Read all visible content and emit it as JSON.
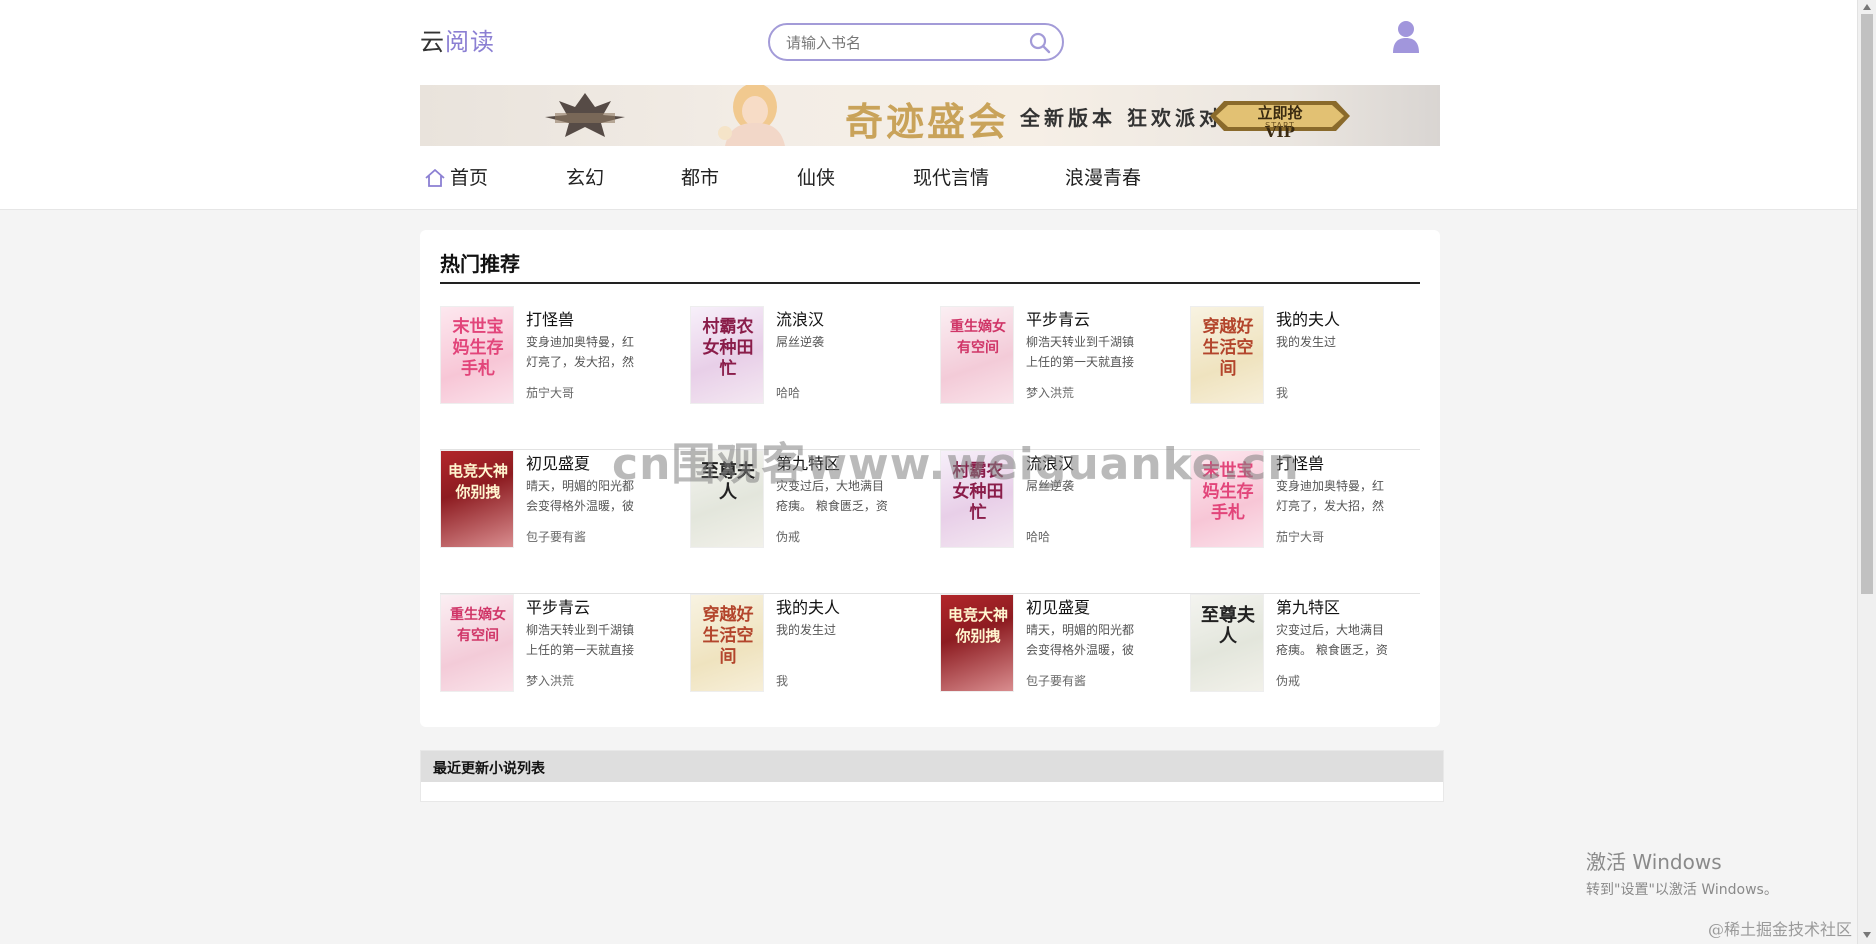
{
  "header": {
    "logo_part1": "云",
    "logo_part2": "阅读",
    "search_placeholder": "请输入书名"
  },
  "banner": {
    "title": "奇迹盛会",
    "slogan": "全新版本 狂欢派对",
    "vip_label": "立即抢VIP",
    "vip_sub": "START"
  },
  "nav": {
    "items": [
      {
        "label": "首页",
        "icon": "home-icon"
      },
      {
        "label": "玄幻"
      },
      {
        "label": "都市"
      },
      {
        "label": "仙侠"
      },
      {
        "label": "现代言情"
      },
      {
        "label": "浪漫青春"
      }
    ]
  },
  "hot": {
    "title": "热门推荐",
    "rows": [
      [
        {
          "title": "打怪兽",
          "desc": "变身迪加奥特曼，红灯亮了，发大招，然",
          "author": "茄宁大哥",
          "cover_text": "末世宝妈生存手札"
        },
        {
          "title": "流浪汉",
          "desc": "屌丝逆袭",
          "author": "哈哈",
          "cover_text": "村霸农女种田忙"
        },
        {
          "title": "平步青云",
          "desc": "柳浩天转业到千湖镇上任的第一天就直接",
          "author": "梦入洪荒",
          "cover_text": "重生嫡女有空间"
        },
        {
          "title": "我的夫人",
          "desc": "我的发生过",
          "author": "我",
          "cover_text": "穿越好生活空间"
        }
      ],
      [
        {
          "title": "初见盛夏",
          "desc": "晴天，明媚的阳光都会变得格外温暖，彼",
          "author": "包子要有酱",
          "cover_text": "电竞大神你别拽"
        },
        {
          "title": "第九特区",
          "desc": "灾变过后，大地满目疮痍。 粮食匮乏，资",
          "author": "伪戒",
          "cover_text": "至尊夫人"
        },
        {
          "title": "流浪汉",
          "desc": "屌丝逆袭",
          "author": "哈哈",
          "cover_text": "村霸农女种田忙"
        },
        {
          "title": "打怪兽",
          "desc": "变身迪加奥特曼，红灯亮了，发大招，然",
          "author": "茄宁大哥",
          "cover_text": "末世宝妈生存手札"
        }
      ],
      [
        {
          "title": "平步青云",
          "desc": "柳浩天转业到千湖镇上任的第一天就直接",
          "author": "梦入洪荒",
          "cover_text": "重生嫡女有空间"
        },
        {
          "title": "我的夫人",
          "desc": "我的发生过",
          "author": "我",
          "cover_text": "穿越好生活空间"
        },
        {
          "title": "初见盛夏",
          "desc": "晴天，明媚的阳光都会变得格外温暖，彼",
          "author": "包子要有酱",
          "cover_text": "电竞大神你别拽"
        },
        {
          "title": "第九特区",
          "desc": "灾变过后，大地满目疮痍。 粮食匮乏，资",
          "author": "伪戒",
          "cover_text": "至尊夫人"
        }
      ]
    ]
  },
  "recent": {
    "title": "最近更新小说列表"
  },
  "overlay": {
    "watermark": "cn围观客www.weiguanke.cn",
    "activate_line1": "激活 Windows",
    "activate_line2": "转到\"设置\"以激活 Windows。",
    "credit": "@稀土掘金技术社区"
  },
  "colors": {
    "accent": "#8b7fd3",
    "search_border": "#a39bd8",
    "avatar": "#a196dc"
  }
}
